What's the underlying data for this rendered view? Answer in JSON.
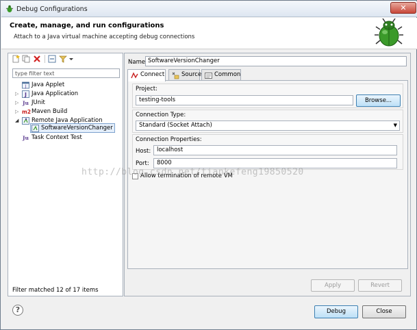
{
  "window": {
    "title": "Debug Configurations",
    "close_glyph": "✕"
  },
  "header": {
    "title": "Create, manage, and run configurations",
    "subtitle": "Attach to a Java virtual machine accepting debug connections",
    "icon": "bug-icon"
  },
  "left_panel": {
    "toolbar_icons": [
      "new-configuration-icon",
      "duplicate-icon",
      "delete-icon",
      "collapse-all-icon",
      "filter-icon"
    ],
    "filter_placeholder": "type filter text",
    "tree": [
      {
        "label": "Java Applet",
        "icon": "java-applet-icon",
        "icon_glyph": "",
        "expanded": null
      },
      {
        "label": "Java Application",
        "icon": "java-application-icon",
        "icon_glyph": "J",
        "expanded": false
      },
      {
        "label": "JUnit",
        "icon": "junit-icon",
        "icon_glyph": "Ju",
        "expanded": false
      },
      {
        "label": "Maven Build",
        "icon": "maven-icon",
        "icon_glyph": "m2",
        "expanded": false
      },
      {
        "label": "Remote Java Application",
        "icon": "remote-java-icon",
        "icon_glyph": "",
        "expanded": true
      },
      {
        "label": "SoftwareVersionChanger",
        "icon": "remote-config-icon",
        "icon_glyph": "",
        "selected": true
      },
      {
        "label": "Task Context Test",
        "icon": "task-context-icon",
        "icon_glyph": "Ju",
        "expanded": null
      }
    ],
    "filter_status": "Filter matched 12 of 17 items"
  },
  "right_panel": {
    "name_label": "Name:",
    "name_value": "SoftwareVersionChanger",
    "tabs": [
      {
        "label": "Connect",
        "icon": "connect-icon",
        "active": true
      },
      {
        "label": "Source",
        "icon": "source-icon",
        "active": false
      },
      {
        "label": "Common",
        "icon": "common-icon",
        "active": false
      }
    ],
    "project": {
      "label": "Project:",
      "value": "testing-tools",
      "browse_label": "Browse..."
    },
    "connection_type": {
      "label": "Connection Type:",
      "value": "Standard (Socket Attach)"
    },
    "connection_properties": {
      "label": "Connection Properties:",
      "host_label": "Host:",
      "host_value": "localhost",
      "port_label": "Port:",
      "port_value": "8000"
    },
    "allow_termination": {
      "label": "Allow termination of remote VM",
      "checked": false
    },
    "apply_label": "Apply",
    "revert_label": "Revert"
  },
  "watermark": "http://blog.csdn.net/tiankefeng19850520",
  "footer": {
    "help_glyph": "?",
    "debug_label": "Debug",
    "close_label": "Close"
  },
  "colors": {
    "bug_green": "#3b9a2a",
    "selection": "#e4eefa",
    "delete_red": "#d22020"
  }
}
